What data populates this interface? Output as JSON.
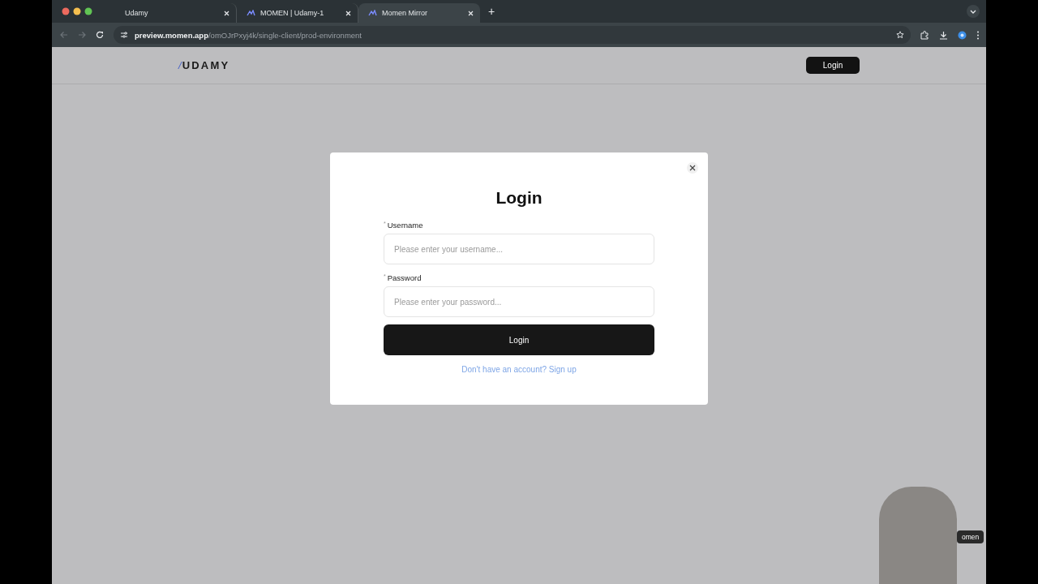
{
  "browser": {
    "tabs": [
      {
        "title": "Udamy",
        "selected": false,
        "favicon": false
      },
      {
        "title": "MOMEN | Udamy-1",
        "selected": false,
        "favicon": true
      },
      {
        "title": "Momen Mirror",
        "selected": true,
        "favicon": true
      }
    ],
    "new_tab": "+",
    "address": {
      "host": "preview.momen.app",
      "path": "/omOJrPxyj4k/single-client/prod-environment"
    }
  },
  "site_header": {
    "logo": {
      "slash": "/",
      "text": "UDAMY"
    },
    "login_button": "Login"
  },
  "login_dialog": {
    "title": "Login",
    "fields": [
      {
        "marker": "*",
        "label": "Username",
        "placeholder": "Please enter your username..."
      },
      {
        "marker": "*",
        "label": "Password",
        "placeholder": "Please enter your password..."
      }
    ],
    "submit": "Login",
    "signup_link": "Don't have an account? Sign up"
  },
  "webcam": {
    "name_tag": "omen"
  }
}
